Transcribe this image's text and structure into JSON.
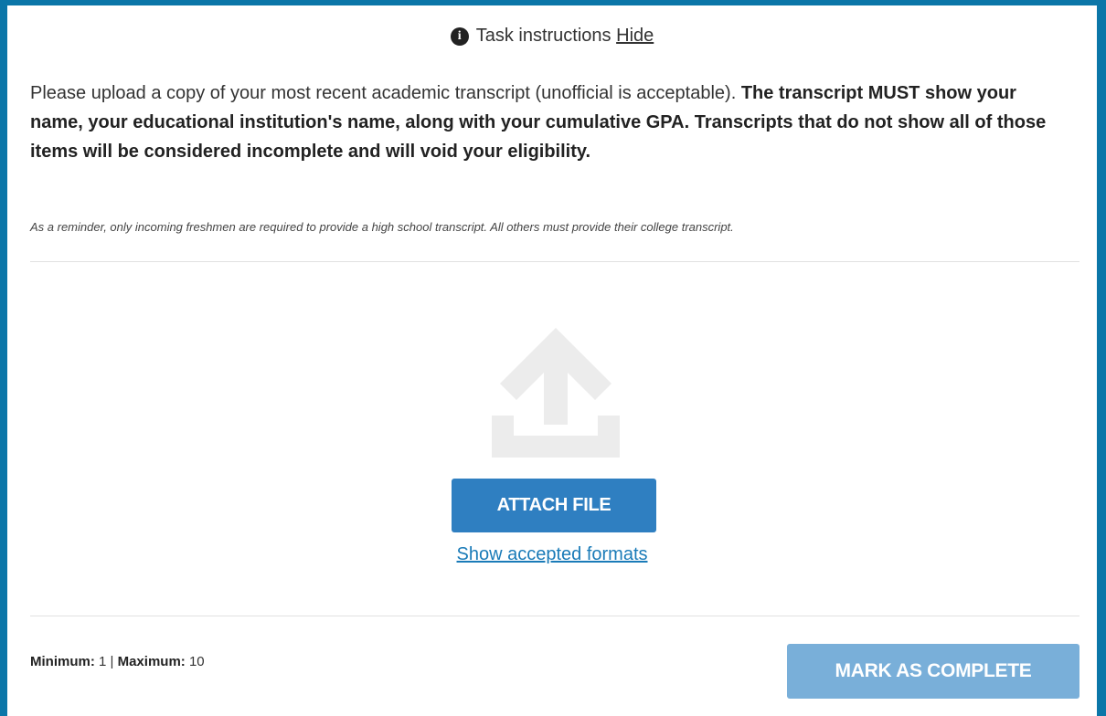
{
  "task_instructions": {
    "label": "Task instructions",
    "hide_link": "Hide",
    "icon": "info-icon"
  },
  "instructions": {
    "normal_text": "Please upload a copy of your most recent academic transcript (unofficial is acceptable).",
    "bold_text": "The transcript MUST show your name, your educational institution's name, along with your cumulative GPA. Transcripts that do not show all of those items will be considered incomplete and will void your eligibility.",
    "reminder": "As a reminder, only incoming freshmen are required to provide a high school transcript. All others must provide their college transcript."
  },
  "upload": {
    "icon": "upload-icon",
    "attach_button": "ATTACH FILE",
    "formats_link": "Show accepted formats"
  },
  "limits": {
    "minimum_label": "Minimum:",
    "minimum_value": "1",
    "separator": "|",
    "maximum_label": "Maximum:",
    "maximum_value": "10"
  },
  "complete_button": "MARK AS COMPLETE",
  "colors": {
    "frame": "#0b76a8",
    "primary_button": "#2f7fc1",
    "disabled_button": "#79afd9",
    "link": "#1a7bb8"
  }
}
